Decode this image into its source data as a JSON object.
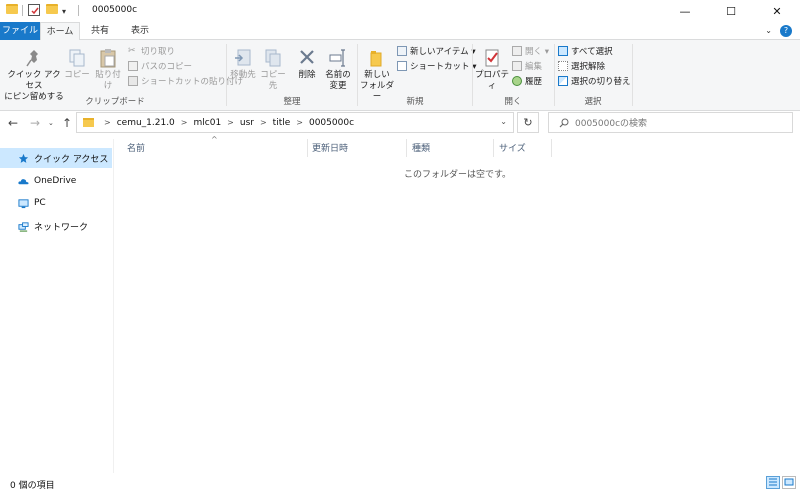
{
  "window": {
    "title": "0005000c",
    "controls": {
      "minimize": "—",
      "maximize": "☐",
      "close": "✕"
    }
  },
  "tabs": {
    "file": "ファイル",
    "home": "ホーム",
    "share": "共有",
    "view": "表示",
    "ribbon_toggle": "⌄",
    "help": "?"
  },
  "ribbon": {
    "clipboard": {
      "label": "クリップボード",
      "pin_line1": "クイック アクセス",
      "pin_line2": "にピン留めする",
      "copy": "コピー",
      "paste": "貼り付け",
      "cut": "切り取り",
      "copy_path": "パスのコピー",
      "paste_shortcut": "ショートカットの貼り付け"
    },
    "organize": {
      "label": "整理",
      "move_to": "移動先",
      "copy_to": "コピー先",
      "delete": "削除",
      "rename_line1": "名前の",
      "rename_line2": "変更"
    },
    "new": {
      "label": "新規",
      "new_folder_line1": "新しい",
      "new_folder_line2": "フォルダー",
      "new_item": "新しいアイテム ▾",
      "shortcut": "ショートカット ▾"
    },
    "open": {
      "label": "開く",
      "properties": "プロパティ",
      "open": "開く ▾",
      "edit": "編集",
      "history": "履歴"
    },
    "select": {
      "label": "選択",
      "select_all": "すべて選択",
      "select_none": "選択解除",
      "invert": "選択の切り替え"
    }
  },
  "nav": {
    "back": "←",
    "forward": "→",
    "recent": "⌄",
    "up": "↑",
    "breadcrumbs": [
      "cemu_1.21.0",
      "mlc01",
      "usr",
      "title",
      "0005000c"
    ],
    "crumb_sep": ">",
    "dropdown": "⌄",
    "refresh": "↻",
    "search_placeholder": "0005000cの検索"
  },
  "sidebar": {
    "items": [
      {
        "label": "クイック アクセス",
        "icon": "star-icon"
      },
      {
        "label": "OneDrive",
        "icon": "cloud-icon"
      },
      {
        "label": "PC",
        "icon": "monitor-icon"
      },
      {
        "label": "ネットワーク",
        "icon": "network-icon"
      }
    ]
  },
  "columns": {
    "name": "名前",
    "modified": "更新日時",
    "type": "種類",
    "size": "サイズ",
    "sort_indicator": "^"
  },
  "content": {
    "empty_message": "このフォルダーは空です。"
  },
  "status": {
    "item_count": "0 個の項目"
  },
  "colors": {
    "accent": "#1979ca",
    "selected": "#cce8ff",
    "folder": "#f6c94e"
  }
}
